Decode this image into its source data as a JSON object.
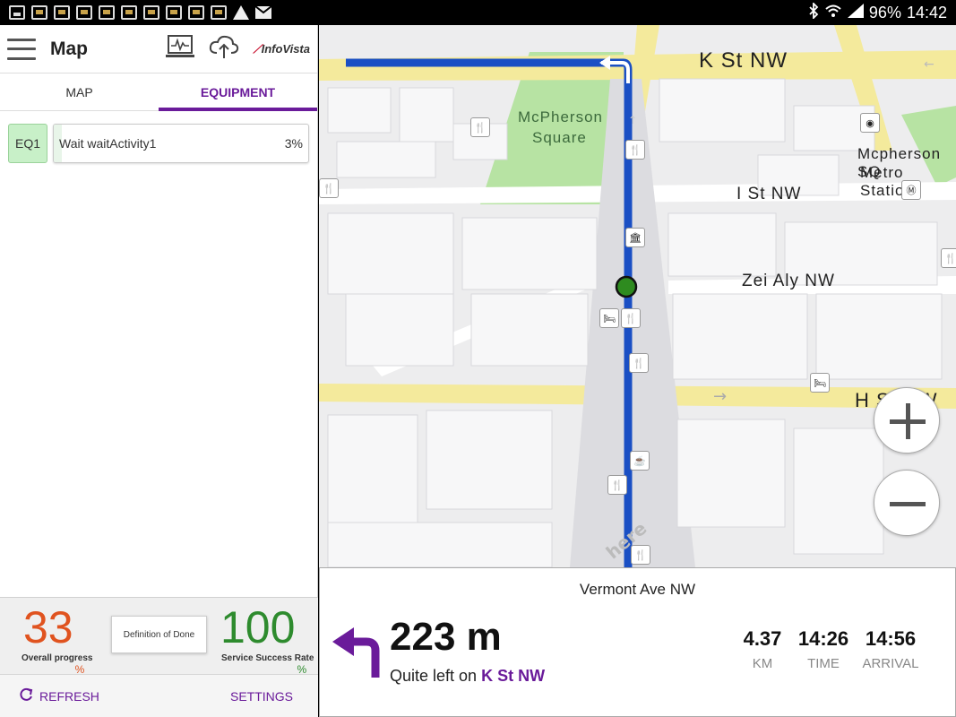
{
  "status_bar": {
    "battery": "96%",
    "time": "14:42",
    "icons": [
      "image-icon",
      "app-icon",
      "app-icon",
      "app-icon",
      "app-icon",
      "app-icon",
      "app-icon",
      "app-icon",
      "app-icon",
      "app-icon",
      "warning-icon",
      "mail-icon",
      "bluetooth-icon",
      "wifi-icon",
      "signal-icon"
    ]
  },
  "appbar": {
    "title": "Map",
    "logo_text": "InfoVista",
    "icons": [
      "menu-icon",
      "monitor-icon",
      "cloud-upload-icon",
      "infovista-logo"
    ]
  },
  "tabs": [
    {
      "label": "MAP",
      "active": false
    },
    {
      "label": "EQUIPMENT",
      "active": true
    }
  ],
  "equipment": [
    {
      "id": "EQ1",
      "activity": "Wait waitActivity1",
      "progress_text": "3%",
      "progress": 0.03
    }
  ],
  "stats": {
    "overall_progress": {
      "value": "33",
      "unit": "%",
      "label": "Overall progress",
      "color": "#e0531f"
    },
    "definition_of_done": "Definition of Done",
    "success_rate": {
      "value": "100",
      "unit": "%",
      "label": "Service Success Rate",
      "color": "#2e8b2e"
    }
  },
  "bottom_bar": {
    "refresh_label": "REFRESH",
    "settings_label": "SETTINGS"
  },
  "map": {
    "labels": {
      "k_st": "K St NW",
      "mcpherson": "McPherson",
      "square": "Square",
      "metro1": "Mcpherson SQ",
      "metro2": "Metro Station",
      "i_st": "I St NW",
      "zei": "Zei Aly NW",
      "h_st": "H St NW"
    },
    "watermark": "here",
    "zoom_in": "+",
    "zoom_out": "−",
    "route_color": "#1a4fc4",
    "park_color": "#b7e3a3",
    "road_major_color": "#f4ea9c"
  },
  "navigation": {
    "street": "Vermont Ave NW",
    "distance": "223 m",
    "instruction_prefix": "Quite left on ",
    "instruction_street": "K St NW",
    "km_value": "4.37",
    "km_label": "KM",
    "time_value": "14:26",
    "time_label": "TIME",
    "arrival_value": "14:56",
    "arrival_label": "ARRIVAL",
    "arrow_color": "#6a1b9a"
  }
}
